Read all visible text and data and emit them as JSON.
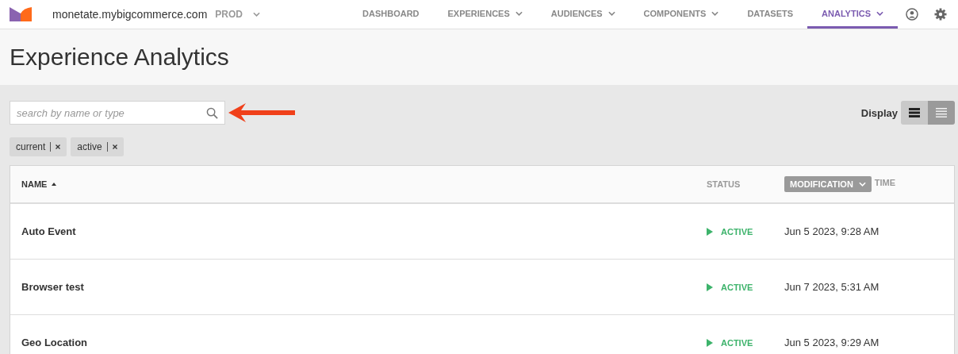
{
  "header": {
    "site": "monetate.mybigcommerce.com",
    "environment": "PROD",
    "nav": [
      {
        "label": "DASHBOARD",
        "dropdown": false,
        "selected": false
      },
      {
        "label": "EXPERIENCES",
        "dropdown": true,
        "selected": false
      },
      {
        "label": "AUDIENCES",
        "dropdown": true,
        "selected": false
      },
      {
        "label": "COMPONENTS",
        "dropdown": true,
        "selected": false
      },
      {
        "label": "DATASETS",
        "dropdown": false,
        "selected": false
      },
      {
        "label": "ANALYTICS",
        "dropdown": true,
        "selected": true
      }
    ]
  },
  "page_title": "Experience Analytics",
  "search": {
    "placeholder": "search by name or type"
  },
  "display": {
    "label": "Display",
    "options": [
      {
        "kind": "compact",
        "selected": false
      },
      {
        "kind": "list",
        "selected": true
      }
    ]
  },
  "filters": [
    "current",
    "active"
  ],
  "table": {
    "columns": [
      {
        "label": "NAME",
        "kind": "sorted"
      },
      {
        "label": "STATUS",
        "kind": "plain"
      },
      {
        "label": "MODIFICATION",
        "kind": "dropdown"
      },
      {
        "label": "TIME",
        "kind": "plain"
      }
    ],
    "rows": [
      {
        "name": "Auto Event",
        "status": "ACTIVE",
        "color": "#3db36b",
        "modified": "Jun 5 2023, 9:28 AM"
      },
      {
        "name": "Browser test",
        "status": "ACTIVE",
        "color": "#3db36b",
        "modified": "Jun 7 2023, 5:31 AM"
      },
      {
        "name": "Geo Location",
        "status": "ACTIVE",
        "color": "#3db36b",
        "modified": "Jun 5 2023, 9:29 AM"
      }
    ]
  }
}
